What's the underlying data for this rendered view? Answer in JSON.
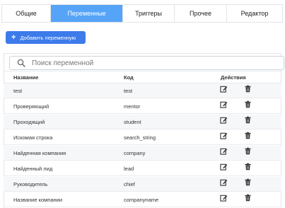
{
  "tabs": [
    {
      "label": "Общие",
      "active": false
    },
    {
      "label": "Переменные",
      "active": true
    },
    {
      "label": "Триггеры",
      "active": false
    },
    {
      "label": "Прочее",
      "active": false
    },
    {
      "label": "Редактор",
      "active": false
    }
  ],
  "toolbar": {
    "add_icon": "plus-icon",
    "add_label": "Добавить переменную"
  },
  "search": {
    "icon": "search-icon",
    "placeholder": "Поиск переменной",
    "value": ""
  },
  "table": {
    "columns": {
      "name": "Название",
      "code": "Код",
      "actions": "Действия"
    },
    "action_icons": {
      "edit": "edit-icon",
      "delete": "trash-icon"
    },
    "rows": [
      {
        "name": "test",
        "code": "test"
      },
      {
        "name": "Проверяющий",
        "code": "mentor"
      },
      {
        "name": "Проходящий",
        "code": "student"
      },
      {
        "name": "Искомая строка",
        "code": "search_string"
      },
      {
        "name": "Найденная компания",
        "code": "company"
      },
      {
        "name": "Найденный лид",
        "code": "lead"
      },
      {
        "name": "Руководитель",
        "code": "chief"
      },
      {
        "name": "Название компании",
        "code": "companyname"
      }
    ]
  },
  "colors": {
    "active_tab": "#56a4f8",
    "primary_button": "#3d7bea",
    "icon": "#333333"
  }
}
